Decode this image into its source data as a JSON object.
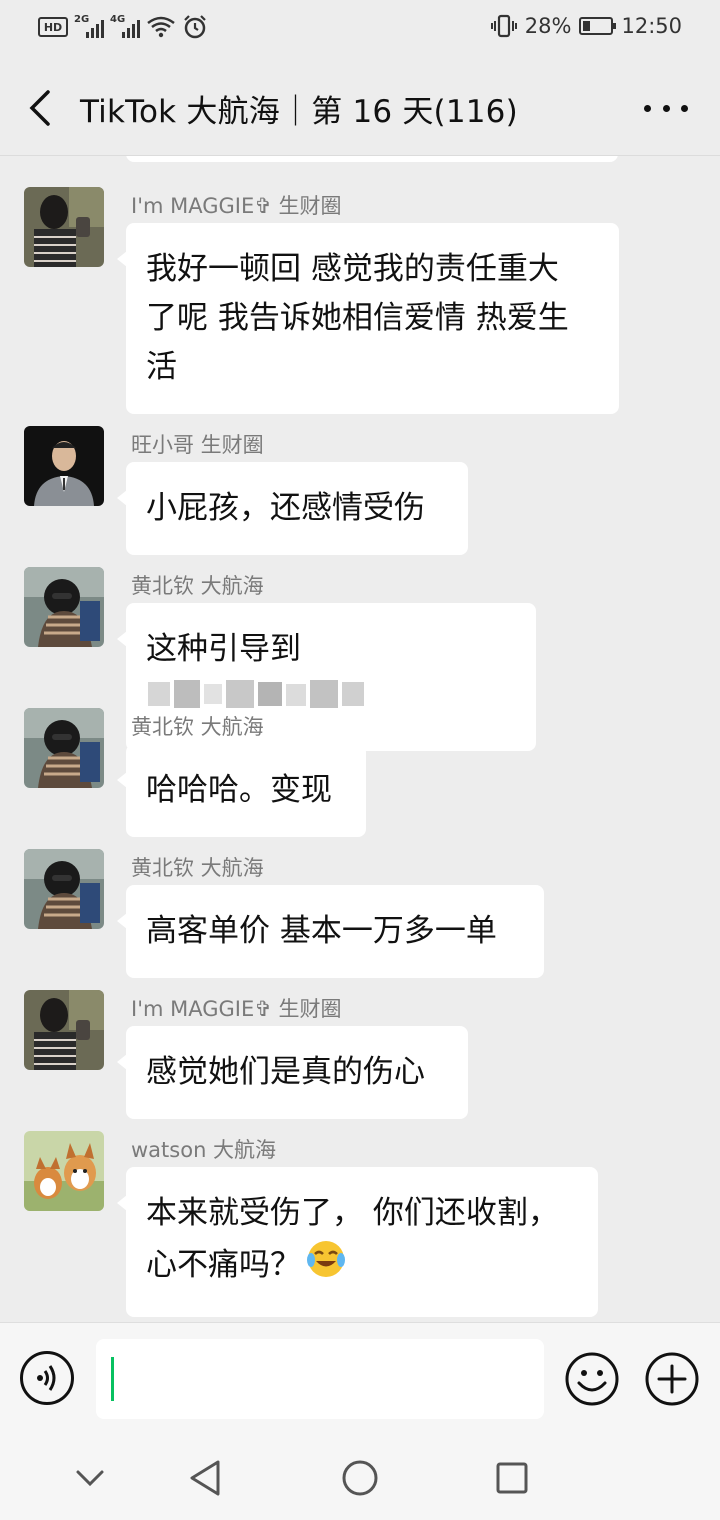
{
  "status_bar": {
    "hd_label": "HD",
    "net1": "2G",
    "net2": "4G",
    "battery": "28%",
    "battery_level": 0.28,
    "time": "12:50"
  },
  "header": {
    "title": "TikTok 大航海｜第 16 天(116)"
  },
  "messages": [
    {
      "sender": "I'm MAGGIE✞ 生财圈",
      "lines": [
        "我好一顿回 感觉我的责任重大",
        "了呢 我告诉她相信爱情 热爱生",
        "活"
      ],
      "avatar": "woman-photo"
    },
    {
      "sender": "旺小哥 生财圈",
      "lines": [
        "小屁孩，还感情受伤"
      ],
      "avatar": "man-in-suit"
    },
    {
      "sender": "黄北钦 大航海",
      "lines": [
        "这种引导到"
      ],
      "avatar": "masked-person",
      "redacted": true
    },
    {
      "sender": "黄北钦 大航海",
      "lines": [
        "哈哈哈。变现"
      ],
      "avatar": "masked-person"
    },
    {
      "sender": "黄北钦 大航海",
      "lines": [
        "高客单价 基本一万多一单"
      ],
      "avatar": "masked-person"
    },
    {
      "sender": "I'm MAGGIE✞ 生财圈",
      "lines": [
        "感觉她们是真的伤心"
      ],
      "avatar": "woman-photo"
    },
    {
      "sender": "watson 大航海",
      "lines": [
        "本来就受伤了， 你们还收割，",
        "心不痛吗？"
      ],
      "avatar": "corgi-dogs",
      "emoji": "crying-laughing-emoji"
    }
  ],
  "colors": {
    "background": "#ededed",
    "bubble": "#ffffff",
    "caret": "#07c160",
    "sender_text": "#7a7a7a"
  },
  "icons": {
    "back": "chevron-left-icon",
    "more": "more-dots-icon",
    "voice": "voice-icon",
    "emoji": "emoji-icon",
    "plus": "plus-icon",
    "nav_collapse": "chevron-down-icon",
    "nav_back": "triangle-back-icon",
    "nav_home": "circle-home-icon",
    "nav_recent": "square-recent-icon"
  }
}
